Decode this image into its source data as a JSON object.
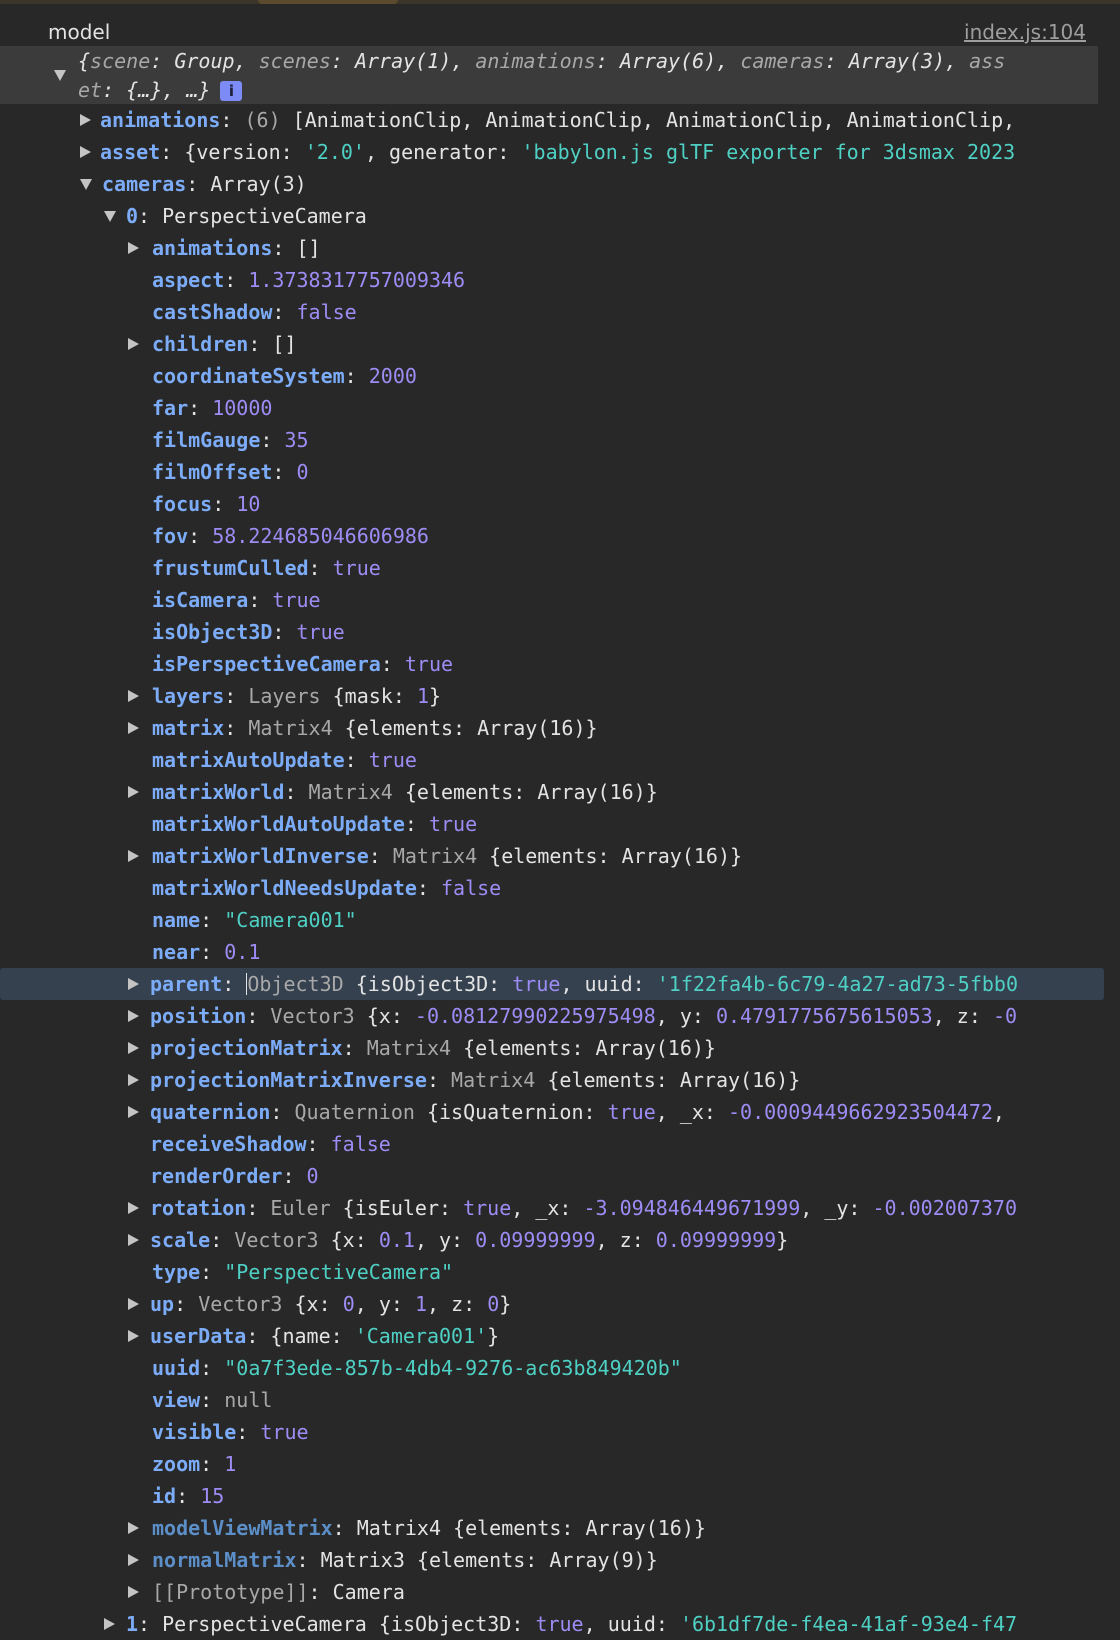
{
  "console": {
    "label": "model",
    "source_link": "index.js:104",
    "summary": {
      "line1": "{scene: Group, scenes: Array(1), animations: Array(6), cameras: Array(3), ass",
      "line2": "et: {…}, …}",
      "info_icon": "i"
    },
    "rows": [
      {
        "key": "animations",
        "prefix": "(6) ",
        "value": "[AnimationClip, AnimationClip, AnimationClip, AnimationClip,"
      },
      {
        "key": "asset",
        "v1": "{version: ",
        "s1": "'2.0'",
        "v2": ", generator: ",
        "s2": "'babylon.js glTF exporter for 3dsmax 2023"
      },
      {
        "key": "cameras",
        "value": "Array(3)"
      },
      {
        "key": "0",
        "value": "PerspectiveCamera"
      },
      {
        "key": "animations",
        "value": "[]"
      },
      {
        "key": "aspect",
        "value": "1.3738317757009346"
      },
      {
        "key": "castShadow",
        "value": "false"
      },
      {
        "key": "children",
        "value": "[]"
      },
      {
        "key": "coordinateSystem",
        "value": "2000"
      },
      {
        "key": "far",
        "value": "10000"
      },
      {
        "key": "filmGauge",
        "value": "35"
      },
      {
        "key": "filmOffset",
        "value": "0"
      },
      {
        "key": "focus",
        "value": "10"
      },
      {
        "key": "fov",
        "value": "58.224685046606986"
      },
      {
        "key": "frustumCulled",
        "value": "true"
      },
      {
        "key": "isCamera",
        "value": "true"
      },
      {
        "key": "isObject3D",
        "value": "true"
      },
      {
        "key": "isPerspectiveCamera",
        "value": "true"
      },
      {
        "key": "layers",
        "cls": "Layers ",
        "v1": "{mask: ",
        "n1": "1",
        "v2": "}"
      },
      {
        "key": "matrix",
        "cls": "Matrix4 ",
        "v1": "{elements: ",
        "a1": "Array(16)",
        "v2": "}"
      },
      {
        "key": "matrixAutoUpdate",
        "value": "true"
      },
      {
        "key": "matrixWorld",
        "cls": "Matrix4 ",
        "v1": "{elements: ",
        "a1": "Array(16)",
        "v2": "}"
      },
      {
        "key": "matrixWorldAutoUpdate",
        "value": "true"
      },
      {
        "key": "matrixWorldInverse",
        "cls": "Matrix4 ",
        "v1": "{elements: ",
        "a1": "Array(16)",
        "v2": "}"
      },
      {
        "key": "matrixWorldNeedsUpdate",
        "value": "false"
      },
      {
        "key": "name",
        "value": "\"Camera001\""
      },
      {
        "key": "near",
        "value": "0.1"
      },
      {
        "key": "parent",
        "pre": "O",
        "cls": "bject3D ",
        "v1": "{isObject3D: ",
        "n1": "true",
        "v2": ", uuid: ",
        "s1": "'1f22fa4b-6c79-4a27-ad73-5fbb0"
      },
      {
        "key": "position",
        "cls": "Vector3 ",
        "v1": "{x: ",
        "n1": "-0.08127990225975498",
        "v2": ", y: ",
        "n2": "0.4791775675615053",
        "v3": ", z: ",
        "n3": "-0"
      },
      {
        "key": "projectionMatrix",
        "cls": "Matrix4 ",
        "v1": "{elements: ",
        "a1": "Array(16)",
        "v2": "}"
      },
      {
        "key": "projectionMatrixInverse",
        "cls": "Matrix4 ",
        "v1": "{elements: ",
        "a1": "Array(16)",
        "v2": "}"
      },
      {
        "key": "quaternion",
        "cls": "Quaternion ",
        "v1": "{isQuaternion: ",
        "n1": "true",
        "v2": ", _x: ",
        "n2": "-0.0009449662923504472",
        "v3": ","
      },
      {
        "key": "receiveShadow",
        "value": "false"
      },
      {
        "key": "renderOrder",
        "value": "0"
      },
      {
        "key": "rotation",
        "cls": "Euler ",
        "v1": "{isEuler: ",
        "n1": "true",
        "v2": ", _x: ",
        "n2": "-3.094846449671999",
        "v3": ", _y: ",
        "n3": "-0.002007370"
      },
      {
        "key": "scale",
        "cls": "Vector3 ",
        "v1": "{x: ",
        "n1": "0.1",
        "v2": ", y: ",
        "n2": "0.09999999",
        "v3": ", z: ",
        "n3": "0.09999999",
        "v4": "}"
      },
      {
        "key": "type",
        "value": "\"PerspectiveCamera\""
      },
      {
        "key": "up",
        "cls": "Vector3 ",
        "v1": "{x: ",
        "n1": "0",
        "v2": ", y: ",
        "n2": "1",
        "v3": ", z: ",
        "n3": "0",
        "v4": "}"
      },
      {
        "key": "userData",
        "v1": "{name: ",
        "s1": "'Camera001'",
        "v2": "}"
      },
      {
        "key": "uuid",
        "value": "\"0a7f3ede-857b-4db4-9276-ac63b849420b\""
      },
      {
        "key": "view",
        "value": "null"
      },
      {
        "key": "visible",
        "value": "true"
      },
      {
        "key": "zoom",
        "value": "1"
      },
      {
        "key": "id",
        "value": "15"
      },
      {
        "key": "modelViewMatrix",
        "cls": "Matrix4 ",
        "v1": "{elements: ",
        "a1": "Array(16)",
        "v2": "}"
      },
      {
        "key": "normalMatrix",
        "cls": "Matrix3 ",
        "v1": "{elements: ",
        "a1": "Array(9)",
        "v2": "}"
      },
      {
        "key": "[[Prototype]]",
        "value": "Camera"
      },
      {
        "key": "1",
        "cls": "PerspectiveCamera ",
        "v1": "{isObject3D: ",
        "n1": "true",
        "v2": ", uuid: ",
        "s1": "'6b1df7de-f4ea-41af-93e4-f47"
      }
    ]
  },
  "colors": {
    "background": "#282828",
    "key": "#7cacf8",
    "number": "#9e8cf5",
    "string": "#4fd0c4",
    "selected_row": "#35414f"
  }
}
